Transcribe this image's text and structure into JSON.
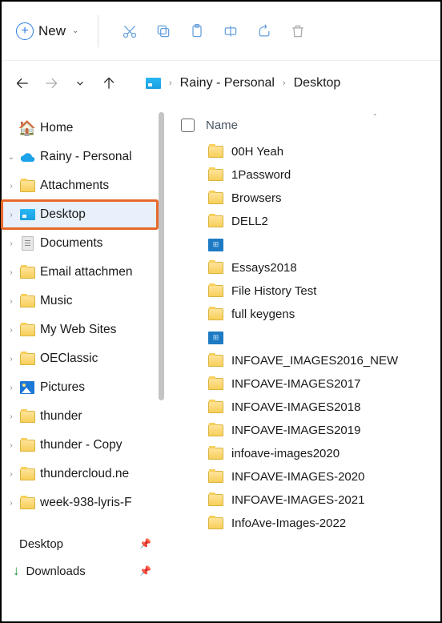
{
  "toolbar": {
    "new_label": "New"
  },
  "breadcrumb": {
    "part1": "Rainy - Personal",
    "part2": "Desktop"
  },
  "sidebar": {
    "home": "Home",
    "root": "Rainy - Personal",
    "items": [
      {
        "label": "Attachments",
        "type": "folder"
      },
      {
        "label": "Desktop",
        "type": "desktop",
        "highlight": true
      },
      {
        "label": "Documents",
        "type": "doc"
      },
      {
        "label": "Email attachmen",
        "type": "folder"
      },
      {
        "label": "Music",
        "type": "folder"
      },
      {
        "label": "My Web Sites",
        "type": "folder"
      },
      {
        "label": "OEClassic",
        "type": "folder"
      },
      {
        "label": "Pictures",
        "type": "pics"
      },
      {
        "label": "thunder",
        "type": "folder"
      },
      {
        "label": "thunder - Copy",
        "type": "folder"
      },
      {
        "label": "thundercloud.ne",
        "type": "folder"
      },
      {
        "label": "week-938-lyris-F",
        "type": "folder"
      }
    ],
    "quick": [
      {
        "label": "Desktop",
        "type": "desktop"
      },
      {
        "label": "Downloads",
        "type": "dl"
      }
    ]
  },
  "header": {
    "name_col": "Name",
    "sort_caret": "ˆ"
  },
  "files": [
    {
      "name": "00H Yeah",
      "type": "folder"
    },
    {
      "name": "1Password",
      "type": "folder"
    },
    {
      "name": "Browsers",
      "type": "folder"
    },
    {
      "name": "DELL2",
      "type": "folder"
    },
    {
      "name": "",
      "type": "ctrl"
    },
    {
      "name": "Essays2018",
      "type": "folder"
    },
    {
      "name": "File History Test",
      "type": "folder"
    },
    {
      "name": "full keygens",
      "type": "folder"
    },
    {
      "name": "",
      "type": "ctrl"
    },
    {
      "name": "INFOAVE_IMAGES2016_NEW",
      "type": "folder"
    },
    {
      "name": "INFOAVE-IMAGES2017",
      "type": "folder"
    },
    {
      "name": "INFOAVE-IMAGES2018",
      "type": "folder"
    },
    {
      "name": "INFOAVE-IMAGES2019",
      "type": "folder"
    },
    {
      "name": "infoave-images2020",
      "type": "folder"
    },
    {
      "name": "INFOAVE-IMAGES-2020",
      "type": "folder"
    },
    {
      "name": "INFOAVE-IMAGES-2021",
      "type": "folder"
    },
    {
      "name": "InfoAve-Images-2022",
      "type": "folder"
    }
  ]
}
